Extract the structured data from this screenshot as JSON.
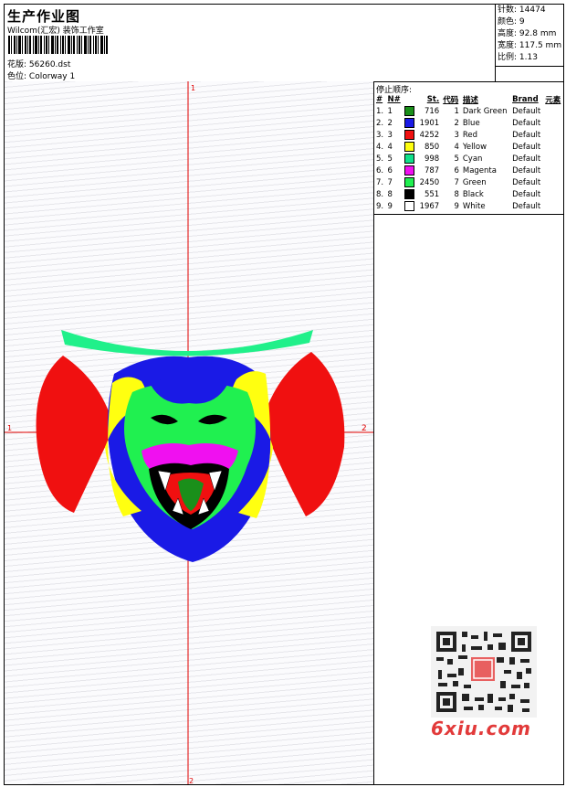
{
  "header": {
    "title": "生产作业图",
    "company": "Wilcom(汇宏) 装饰工作室",
    "design_label": "花版:",
    "design_value": "56260.dst",
    "colorway_label": "色位:",
    "colorway_value": "Colorway 1"
  },
  "stats": [
    {
      "label": "针数:",
      "value": "14474"
    },
    {
      "label": "颜色:",
      "value": "9"
    },
    {
      "label": "高度:",
      "value": "92.8 mm"
    },
    {
      "label": "宽度:",
      "value": "117.5 mm"
    },
    {
      "label": "比例:",
      "value": "1.13"
    }
  ],
  "sequence": {
    "title": "停止顺序:",
    "columns": [
      "#",
      "N#",
      "St.",
      "代码",
      "描述",
      "Brand",
      "元素"
    ],
    "rows": [
      {
        "idx": "1.",
        "n": "1",
        "st": "716",
        "code": "1",
        "desc": "Dark Green",
        "brand": "Default",
        "color": "#1a8f1a"
      },
      {
        "idx": "2.",
        "n": "2",
        "st": "1901",
        "code": "2",
        "desc": "Blue",
        "brand": "Default",
        "color": "#1a1ae6"
      },
      {
        "idx": "3.",
        "n": "3",
        "st": "4252",
        "code": "3",
        "desc": "Red",
        "brand": "Default",
        "color": "#f01010"
      },
      {
        "idx": "4.",
        "n": "4",
        "st": "850",
        "code": "4",
        "desc": "Yellow",
        "brand": "Default",
        "color": "#ffff10"
      },
      {
        "idx": "5.",
        "n": "5",
        "st": "998",
        "code": "5",
        "desc": "Cyan",
        "brand": "Default",
        "color": "#10e08a"
      },
      {
        "idx": "6.",
        "n": "6",
        "st": "787",
        "code": "6",
        "desc": "Magenta",
        "brand": "Default",
        "color": "#f010f0"
      },
      {
        "idx": "7.",
        "n": "7",
        "st": "2450",
        "code": "7",
        "desc": "Green",
        "brand": "Default",
        "color": "#20f050"
      },
      {
        "idx": "8.",
        "n": "8",
        "st": "551",
        "code": "8",
        "desc": "Black",
        "brand": "Default",
        "color": "#000000"
      },
      {
        "idx": "9.",
        "n": "9",
        "st": "1967",
        "code": "9",
        "desc": "White",
        "brand": "Default",
        "color": "#ffffff"
      }
    ]
  },
  "axis_marks": {
    "top": "1",
    "bottom": "2",
    "left": "1",
    "right": "2"
  },
  "watermark": "6xiu.com"
}
